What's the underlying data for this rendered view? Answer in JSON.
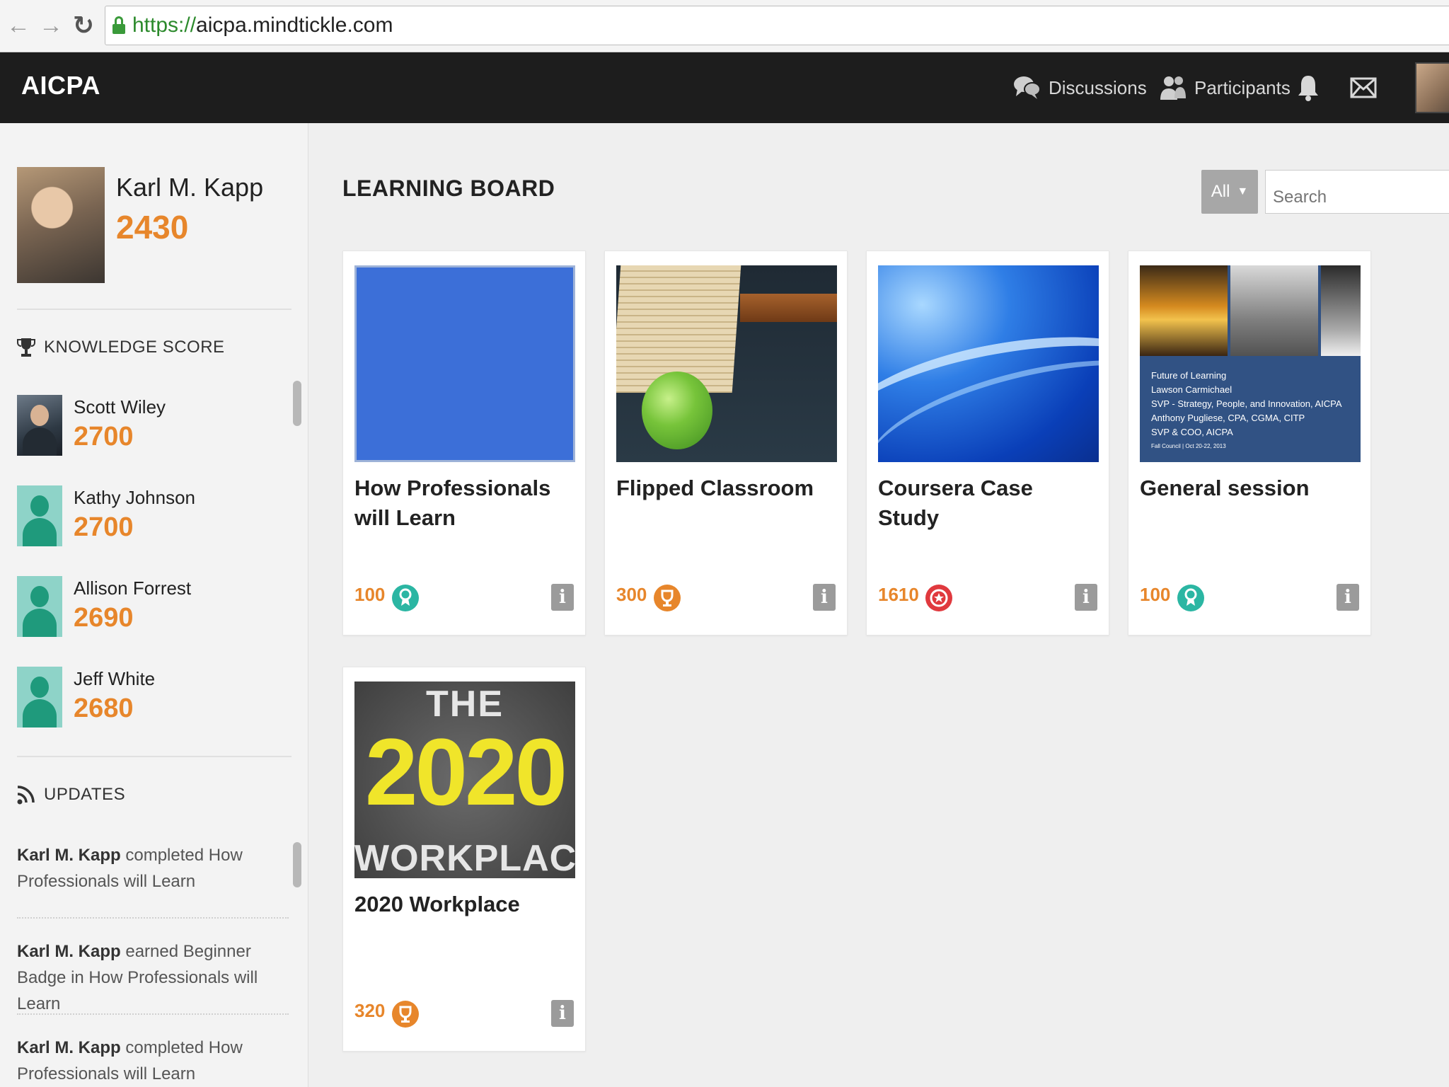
{
  "browser": {
    "url_scheme": "https://",
    "url_host": "aicpa.mindtickle.com"
  },
  "header": {
    "brand": "AICPA",
    "discussions_label": "Discussions",
    "participants_label": "Participants"
  },
  "profile": {
    "name": "Karl M. Kapp",
    "score": "2430"
  },
  "knowledge": {
    "title": "KNOWLEDGE SCORE",
    "leaders": [
      {
        "name": "Scott Wiley",
        "score": "2700"
      },
      {
        "name": "Kathy Johnson",
        "score": "2700"
      },
      {
        "name": "Allison Forrest",
        "score": "2690"
      },
      {
        "name": "Jeff White",
        "score": "2680"
      }
    ]
  },
  "updates": {
    "title": "UPDATES",
    "items": [
      {
        "who": "Karl M. Kapp",
        "what": "completed How Professionals will Learn"
      },
      {
        "who": "Karl M. Kapp",
        "what": "earned Beginner Badge in How Professionals will Learn"
      },
      {
        "who": "Karl M. Kapp",
        "what": "completed How Professionals will Learn"
      }
    ]
  },
  "board": {
    "title": "LEARNING BOARD",
    "filter_value": "All",
    "search_placeholder": "Search",
    "cards": [
      {
        "title": "How Professionals will Learn",
        "points": "100",
        "badge_color": "#2bb6a3"
      },
      {
        "title": "Flipped Classroom",
        "points": "300",
        "badge_color": "#e7862b"
      },
      {
        "title": "Coursera Case Study",
        "points": "1610",
        "badge_color": "#e0393e"
      },
      {
        "title": "General session",
        "points": "100",
        "badge_color": "#2bb6a3"
      },
      {
        "title": "2020 Workplace",
        "points": "320",
        "badge_color": "#e7862b"
      }
    ],
    "session_slide": {
      "line1": "Future of Learning",
      "line2": "Lawson Carmichael",
      "line3": "SVP - Strategy, People, and Innovation, AICPA",
      "line4": "Anthony Pugliese, CPA, CGMA, CITP",
      "line5": "SVP & COO, AICPA",
      "line6": "Fall Council | Oct 20-22, 2013"
    },
    "cover_2020": {
      "the": "THE",
      "year": "2020",
      "workplace": "WORKPLACE"
    }
  },
  "info_glyph": "i"
}
